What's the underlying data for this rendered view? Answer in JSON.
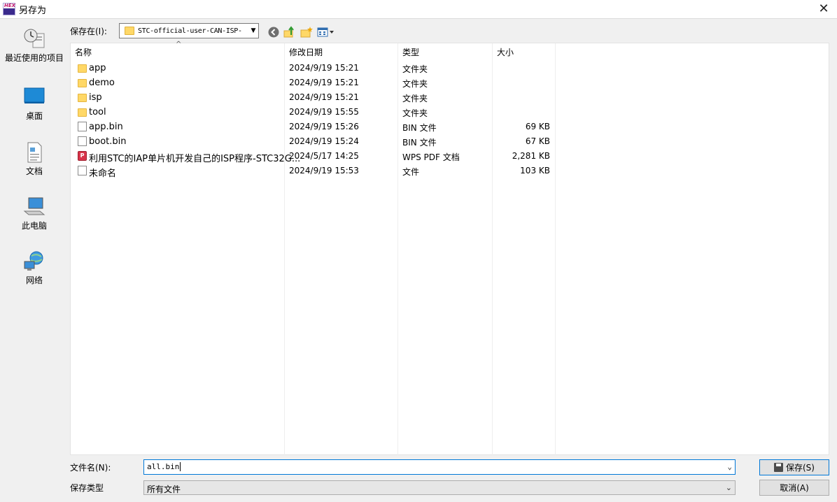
{
  "window": {
    "title": "另存为",
    "close_glyph": "✕",
    "app_icon_text": "HEX"
  },
  "places": [
    {
      "label": "最近使用的项目",
      "icon": "recent-icon"
    },
    {
      "label": "桌面",
      "icon": "desktop-icon"
    },
    {
      "label": "文档",
      "icon": "documents-icon"
    },
    {
      "label": "此电脑",
      "icon": "this-pc-icon"
    },
    {
      "label": "网络",
      "icon": "network-icon"
    }
  ],
  "toolbar": {
    "save_in_label": "保存在(I):",
    "current_folder": "STC-official-user-CAN-ISP-",
    "icons": [
      "back-icon",
      "up-folder-icon",
      "new-folder-icon",
      "view-menu-icon"
    ]
  },
  "list": {
    "columns": [
      "名称",
      "修改日期",
      "类型",
      "大小"
    ],
    "rows": [
      {
        "name": "app",
        "date": "2024/9/19 15:21",
        "type": "文件夹",
        "size": "",
        "icon": "folder"
      },
      {
        "name": "demo",
        "date": "2024/9/19 15:21",
        "type": "文件夹",
        "size": "",
        "icon": "folder"
      },
      {
        "name": "isp",
        "date": "2024/9/19 15:21",
        "type": "文件夹",
        "size": "",
        "icon": "folder"
      },
      {
        "name": "tool",
        "date": "2024/9/19 15:55",
        "type": "文件夹",
        "size": "",
        "icon": "folder"
      },
      {
        "name": "app.bin",
        "date": "2024/9/19 15:26",
        "type": "BIN 文件",
        "size": "69 KB",
        "icon": "file"
      },
      {
        "name": "boot.bin",
        "date": "2024/9/19 15:24",
        "type": "BIN 文件",
        "size": "67 KB",
        "icon": "file"
      },
      {
        "name": "利用STC的IAP单片机开发自己的ISP程序-STC32G...",
        "date": "2024/5/17 14:25",
        "type": "WPS PDF 文档",
        "size": "2,281 KB",
        "icon": "pdf"
      },
      {
        "name": "未命名",
        "date": "2024/9/19 15:53",
        "type": "文件",
        "size": "103 KB",
        "icon": "file"
      }
    ]
  },
  "footer": {
    "filename_label": "文件名(N):",
    "filename_value": "all.bin",
    "filetype_label": "保存类型",
    "filetype_value": "所有文件",
    "save_label": "保存(S)",
    "cancel_label": "取消(A)"
  }
}
